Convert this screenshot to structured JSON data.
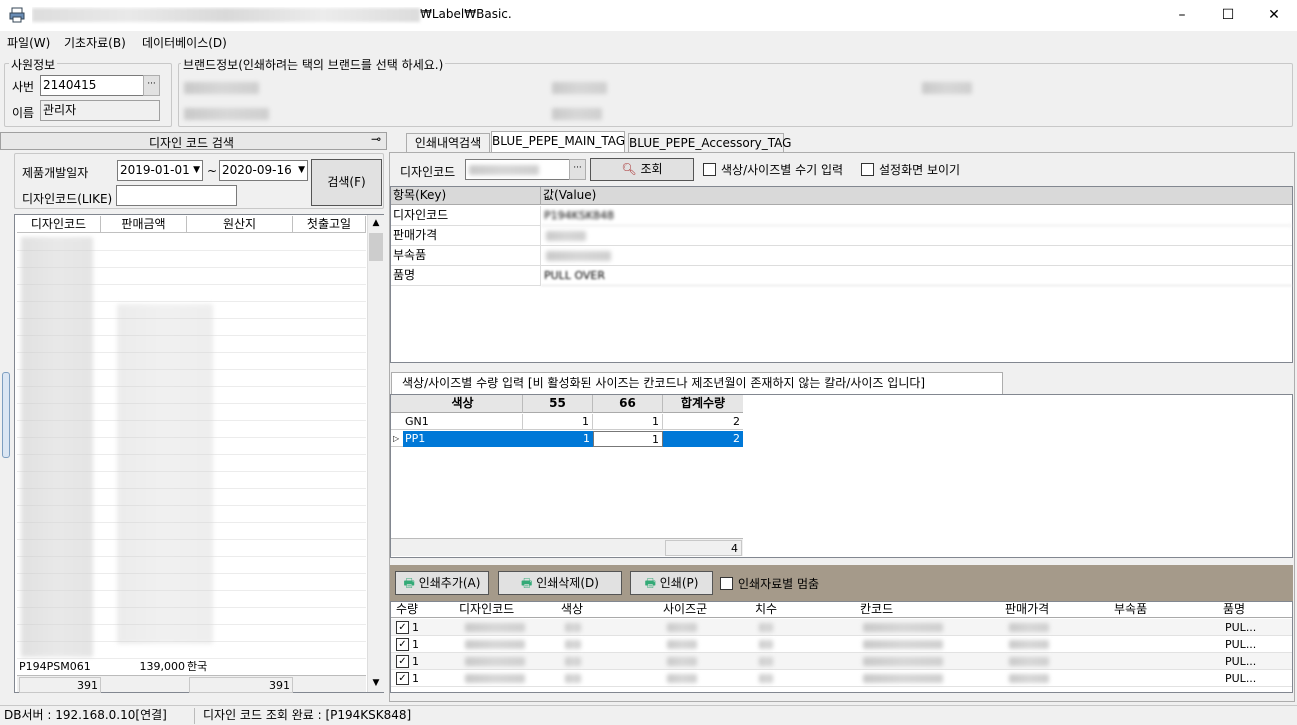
{
  "window": {
    "title_suffix": "₩Label₩Basic.set",
    "min": "–",
    "max": "☐",
    "close": "✕"
  },
  "menu": [
    "파일(W)",
    "기초자료(B)",
    "데이터베이스(D)"
  ],
  "employee": {
    "group_label": "사원정보",
    "id_label": "사번",
    "id_value": "2140415",
    "name_label": "이름",
    "name_value": "관리자",
    "browse": "···"
  },
  "brand": {
    "group_label": "브랜드정보(인쇄하려는 택의 브랜드를 선택 하세요.)"
  },
  "left_panel": {
    "title": "디자인 코드 검색",
    "pin": "⊸",
    "dev_date_label": "제품개발일자",
    "date_from": "2019-01-01",
    "tilde": "~",
    "date_to": "2020-09-16",
    "code_like_label": "디자인코드(LIKE)",
    "code_like_value": "",
    "search_button": "검색(F)",
    "columns": [
      "디자인코드",
      "판매금액",
      "원산지",
      "첫출고일"
    ],
    "last_row": {
      "code": "P194PSM061",
      "price": "139,000",
      "origin": "한국",
      "date": ""
    },
    "footer": [
      "391",
      "391"
    ]
  },
  "tabs": [
    "인쇄내역검색",
    "BLUE_PEPE_MAIN_TAG",
    "BLUE_PEPE_Accessory_TAG"
  ],
  "design": {
    "code_label": "디자인코드",
    "browse": "···",
    "lookup_button": "조회",
    "color_size_manual_label": "색상/사이즈별 수기 입력",
    "show_settings_label": "설정화면 보이기",
    "kv_header": [
      "항목(Key)",
      "값(Value)"
    ],
    "kv_rows": [
      {
        "key": "디자인코드",
        "value": "P194KSK848"
      },
      {
        "key": "판매가격",
        "value": ""
      },
      {
        "key": "부속품",
        "value": ""
      },
      {
        "key": "품명",
        "value": "PULL OVER"
      }
    ]
  },
  "qty": {
    "tab_label": "색상/사이즈별 수량 입력 [비 활성화된 사이즈는 칸코드나 제조년월이 존재하지 않는 칼라/사이즈 입니다]",
    "columns": [
      "색상",
      "55",
      "66",
      "합계수량"
    ],
    "rows": [
      {
        "color": "GN1",
        "s55": "1",
        "s66": "1",
        "total": "2"
      },
      {
        "color": "PP1",
        "s55": "1",
        "s66": "1",
        "total": "2"
      }
    ],
    "total": "4"
  },
  "print": {
    "add_button": "인쇄추가(A)",
    "delete_button": "인쇄삭제(D)",
    "print_button": "인쇄(P)",
    "stop_label": "인쇄자료별 멈춤",
    "columns": [
      "수량",
      "디자인코드",
      "색상",
      "사이즈군",
      "치수",
      "칸코드",
      "판매가격",
      "부속품",
      "품명"
    ],
    "rows": [
      {
        "qty": "1",
        "name": "PUL..."
      },
      {
        "qty": "1",
        "name": "PUL..."
      },
      {
        "qty": "1",
        "name": "PUL..."
      },
      {
        "qty": "1",
        "name": "PUL..."
      }
    ]
  },
  "status": {
    "db": "DB서버 : 192.168.0.10[연결]",
    "message": "디자인 코드 조회 완료 : [P194KSK848]"
  }
}
